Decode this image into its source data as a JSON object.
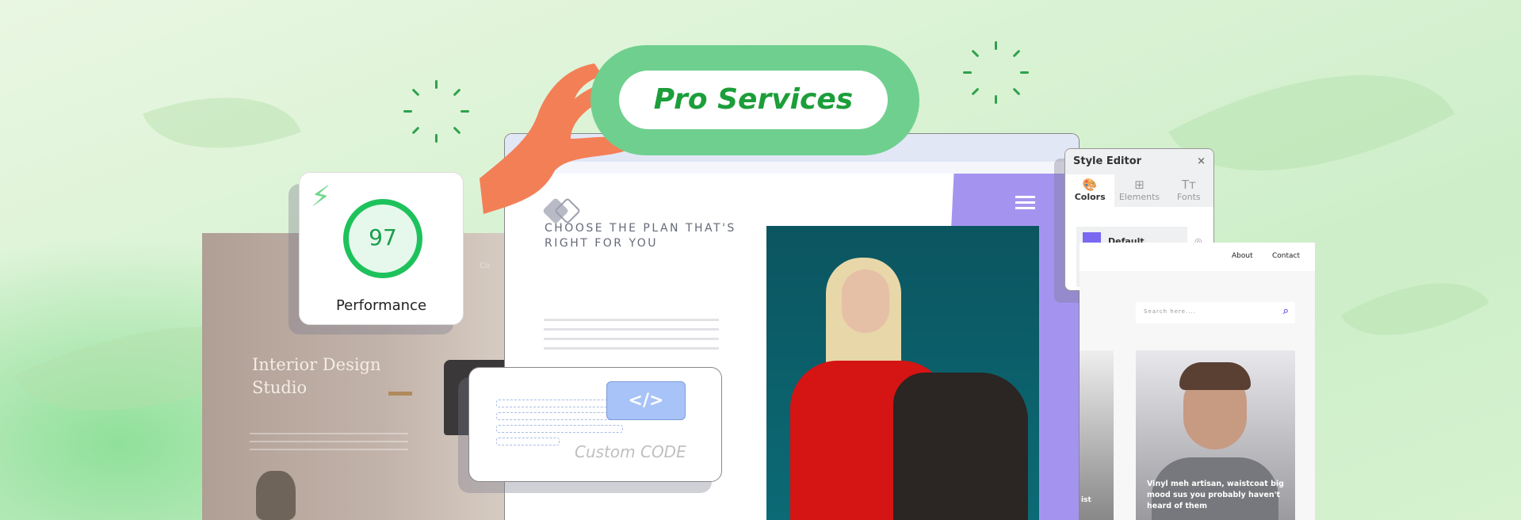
{
  "banner": {
    "title": "Pro Services"
  },
  "performance": {
    "score": "97",
    "label": "Performance",
    "accent": "#1ec25c"
  },
  "interior_site": {
    "title": "Interior Design Studio",
    "nav_snippet": "Co"
  },
  "pricing_site": {
    "heading": "CHOOSE THE PLAN THAT'S RIGHT FOR YOU",
    "accent": "#a594ef"
  },
  "style_editor": {
    "title": "Style Editor",
    "close": "×",
    "tabs": [
      {
        "label": "Colors",
        "icon": "palette-icon"
      },
      {
        "label": "Elements",
        "icon": "layout-icon"
      },
      {
        "label": "Fonts",
        "icon": "text-size-icon"
      }
    ],
    "default_label": "Default",
    "swatches": [
      "#7b68f0",
      "#d0185a",
      "#2b5a80"
    ]
  },
  "blog_site": {
    "nav": [
      "About",
      "Contact"
    ],
    "search_placeholder": "Search here....",
    "caption": "Vinyl meh artisan, waistcoat big mood sus you probably haven't heard of them",
    "side_caption": "ist"
  },
  "code_card": {
    "button": "</>",
    "label": "Custom CODE"
  }
}
